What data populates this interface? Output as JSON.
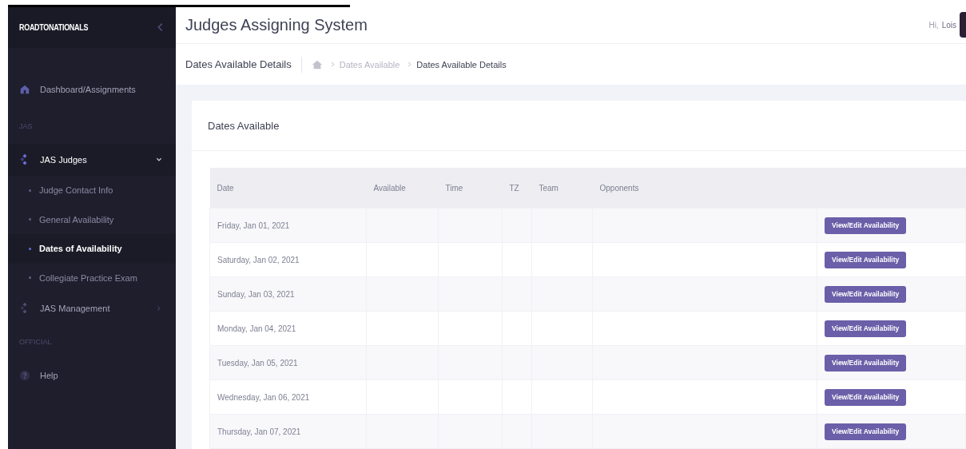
{
  "sidebar": {
    "brand": "ROADTONATIONALS",
    "items": [
      {
        "kind": "home",
        "label": "Dashboard/Assignments"
      },
      {
        "kind": "section",
        "label": "JAS"
      },
      {
        "kind": "group",
        "label": "JAS Judges",
        "expanded": true,
        "children": [
          {
            "label": "Judge Contact Info",
            "selected": false
          },
          {
            "label": "General Availability",
            "selected": false
          },
          {
            "label": "Dates of Availability",
            "selected": true
          },
          {
            "label": "Collegiate Practice Exam",
            "selected": false
          }
        ]
      },
      {
        "kind": "group",
        "label": "JAS Management",
        "expanded": false
      },
      {
        "kind": "section",
        "label": "OFFICIAL"
      },
      {
        "kind": "help",
        "label": "Help"
      }
    ]
  },
  "header": {
    "title": "Judges Assigning System",
    "greeting": "Hi,",
    "user": "Lois"
  },
  "subheader": {
    "title": "Dates Available Details",
    "breadcrumbs": [
      "Dates Available",
      "Dates Available Details"
    ]
  },
  "card": {
    "title": "Dates Available",
    "table": {
      "columns": [
        "Date",
        "Available",
        "Time",
        "TZ",
        "Team",
        "Opponents"
      ],
      "rows": [
        {
          "date": "Friday, Jan 01, 2021",
          "action": "View/Edit Availability"
        },
        {
          "date": "Saturday, Jan 02, 2021",
          "action": "View/Edit Availability"
        },
        {
          "date": "Sunday, Jan 03, 2021",
          "action": "View/Edit Availability"
        },
        {
          "date": "Monday, Jan 04, 2021",
          "action": "View/Edit Availability"
        },
        {
          "date": "Tuesday, Jan 05, 2021",
          "action": "View/Edit Availability"
        },
        {
          "date": "Wednesday, Jan 06, 2021",
          "action": "View/Edit Availability"
        },
        {
          "date": "Thursday, Jan 07, 2021",
          "action": "View/Edit Availability"
        }
      ]
    }
  }
}
